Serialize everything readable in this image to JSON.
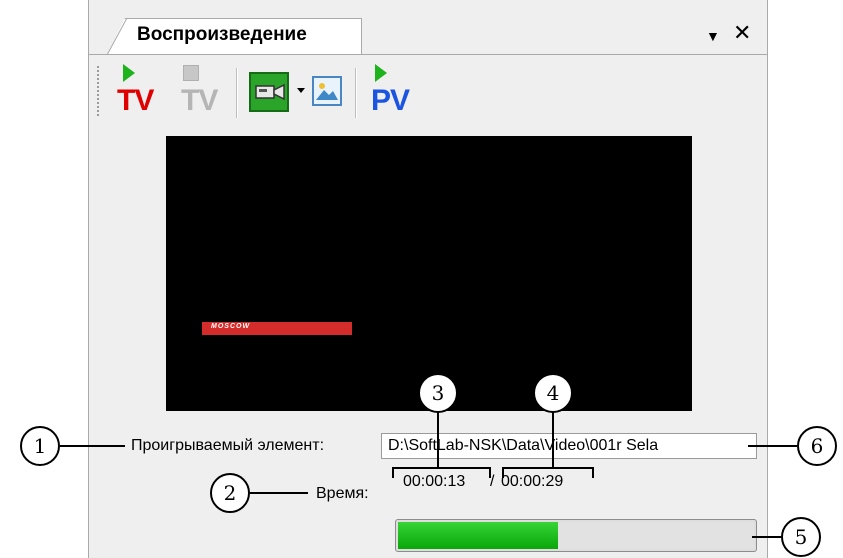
{
  "panel": {
    "tab_title": "Воспроизведение",
    "menu_glyph": "▼",
    "close_glyph": "✕"
  },
  "toolbar": {
    "buttons": [
      {
        "name": "play-tv",
        "label": "TV",
        "color": "#e00000",
        "icon": "play-icon"
      },
      {
        "name": "stop-tv",
        "label": "TV",
        "color": "#b5b5b5",
        "icon": "stop-icon"
      },
      {
        "name": "camera",
        "icon": "video-camera-icon"
      },
      {
        "name": "picture",
        "icon": "picture-icon"
      },
      {
        "name": "play-pv",
        "label": "PV",
        "color": "#1a54e0",
        "icon": "play-icon"
      }
    ]
  },
  "video": {
    "overlay_text": "MOSCOW"
  },
  "form": {
    "element_label": "Проигрываемый элемент:",
    "element_value": "D:\\SoftLab-NSK\\Data\\Video\\001r Sela",
    "time_label": "Время:",
    "time_current": "00:00:13",
    "time_separator": "/",
    "time_total": "00:00:29",
    "progress_fraction": 0.45,
    "progress_color": "#16c016"
  },
  "callouts": [
    "1",
    "2",
    "3",
    "4",
    "5",
    "6"
  ]
}
